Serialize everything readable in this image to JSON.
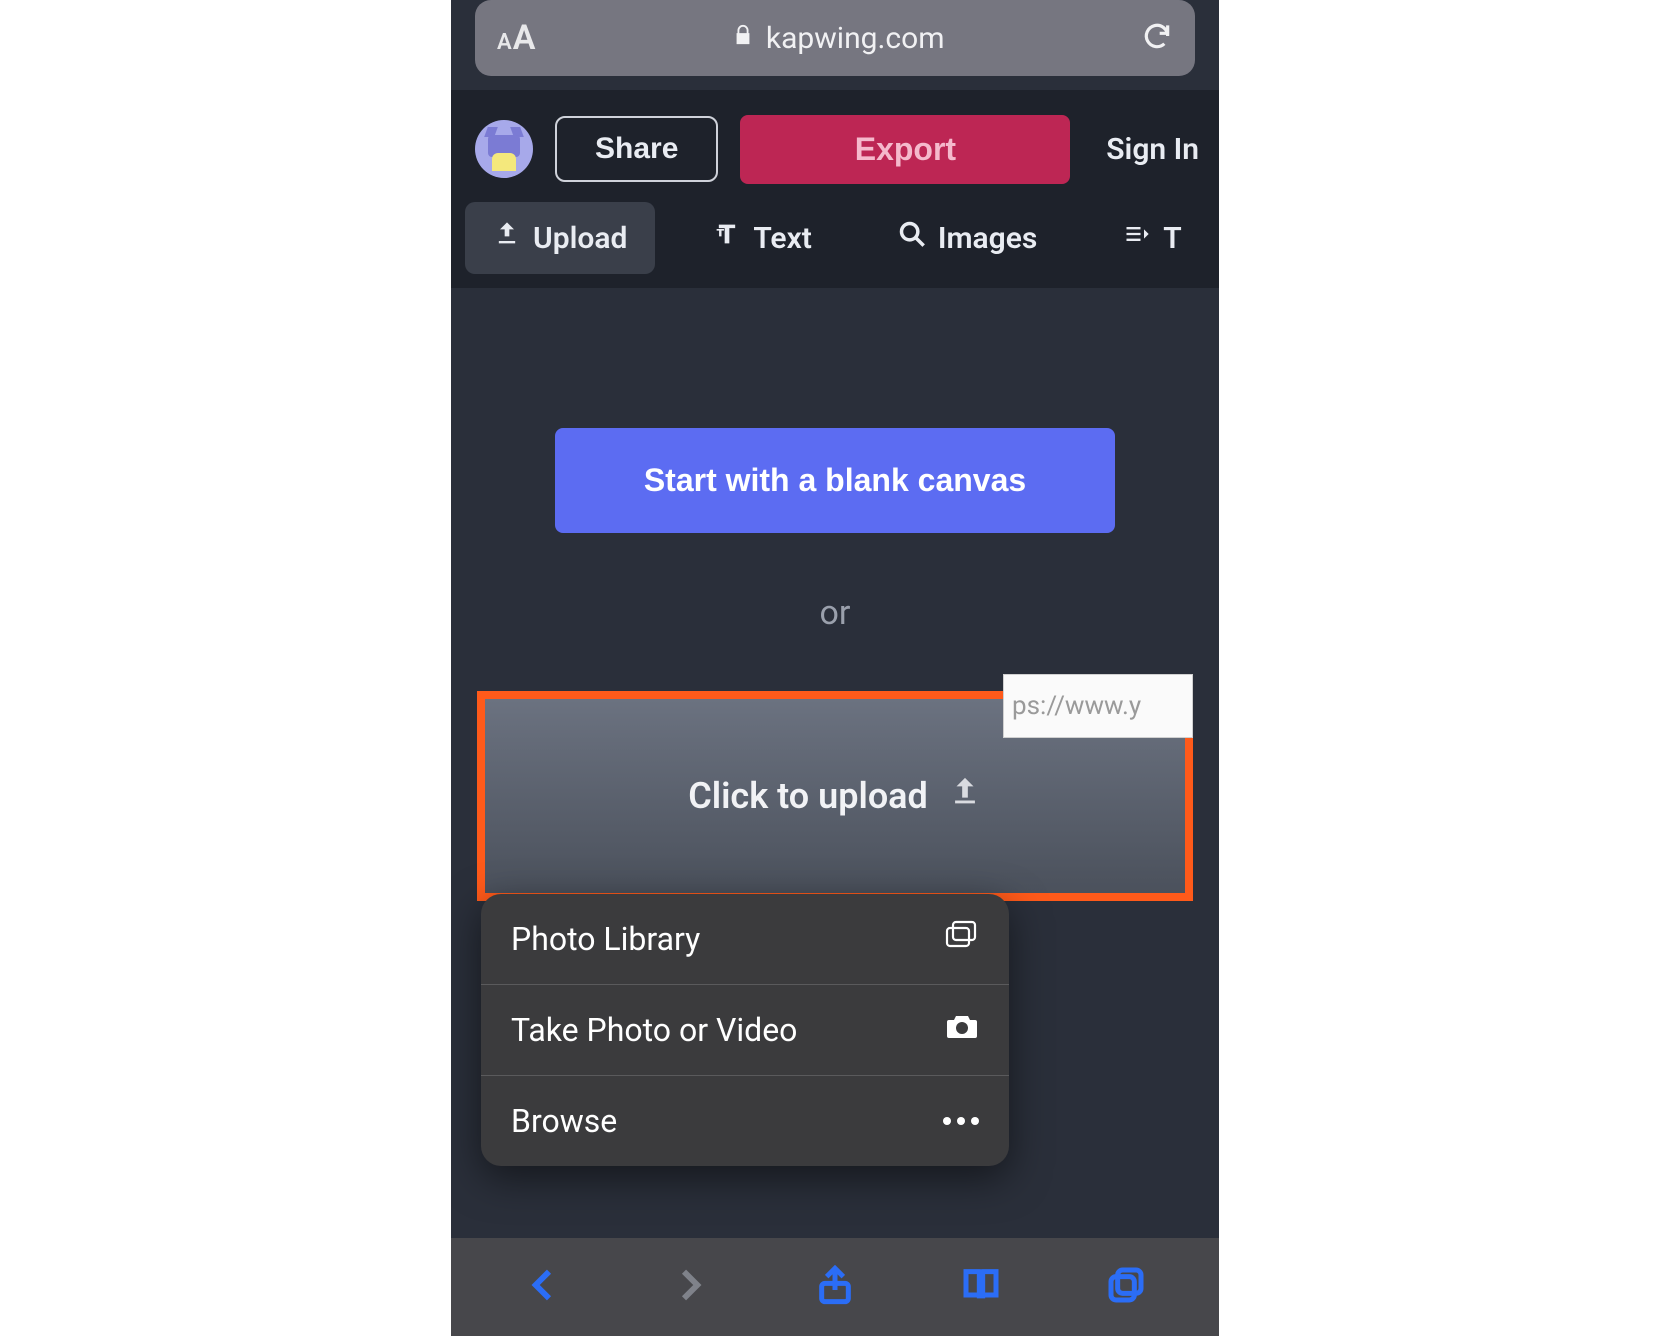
{
  "browser": {
    "domain": "kapwing.com",
    "text_size_label": "AA"
  },
  "header": {
    "share_label": "Share",
    "export_label": "Export",
    "signin_label": "Sign In"
  },
  "toolbar": {
    "upload_label": "Upload",
    "text_label": "Text",
    "images_label": "Images",
    "truncated_label": "T"
  },
  "main": {
    "blank_canvas_label": "Start with a blank canvas",
    "or_label": "or",
    "click_upload_label": "Click to upload",
    "url_placeholder_visible": "ps://www.y"
  },
  "sheet": {
    "items": [
      {
        "label": "Photo Library",
        "icon": "photo-library-icon"
      },
      {
        "label": "Take Photo or Video",
        "icon": "camera-icon"
      },
      {
        "label": "Browse",
        "icon": "more-icon"
      }
    ]
  }
}
